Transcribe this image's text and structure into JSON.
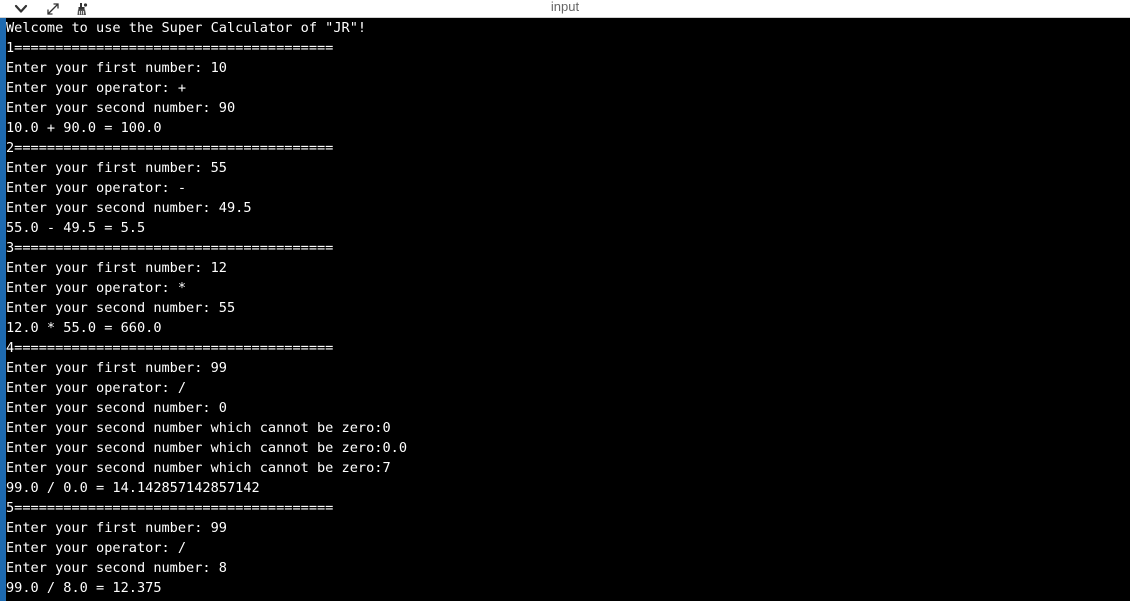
{
  "window": {
    "title": "input",
    "accent_color": "#1e6ab0",
    "background": "#000000",
    "text_color": "#ffffff"
  },
  "titlebar": {
    "icons": [
      "chevron-down-icon",
      "expand-icon",
      "clean-icon"
    ]
  },
  "console": {
    "lines": [
      "Welcome to use the Super Calculator of \"JR\"!",
      "1=======================================",
      "Enter your first number: 10",
      "Enter your operator: +",
      "Enter your second number: 90",
      "10.0 + 90.0 = 100.0",
      "2=======================================",
      "Enter your first number: 55",
      "Enter your operator: -",
      "Enter your second number: 49.5",
      "55.0 - 49.5 = 5.5",
      "3=======================================",
      "Enter your first number: 12",
      "Enter your operator: *",
      "Enter your second number: 55",
      "12.0 * 55.0 = 660.0",
      "4=======================================",
      "Enter your first number: 99",
      "Enter your operator: /",
      "Enter your second number: 0",
      "Enter your second number which cannot be zero:0",
      "Enter your second number which cannot be zero:0.0",
      "Enter your second number which cannot be zero:7",
      "99.0 / 0.0 = 14.142857142857142",
      "5=======================================",
      "Enter your first number: 99",
      "Enter your operator: /",
      "Enter your second number: 8",
      "99.0 / 8.0 = 12.375"
    ]
  }
}
